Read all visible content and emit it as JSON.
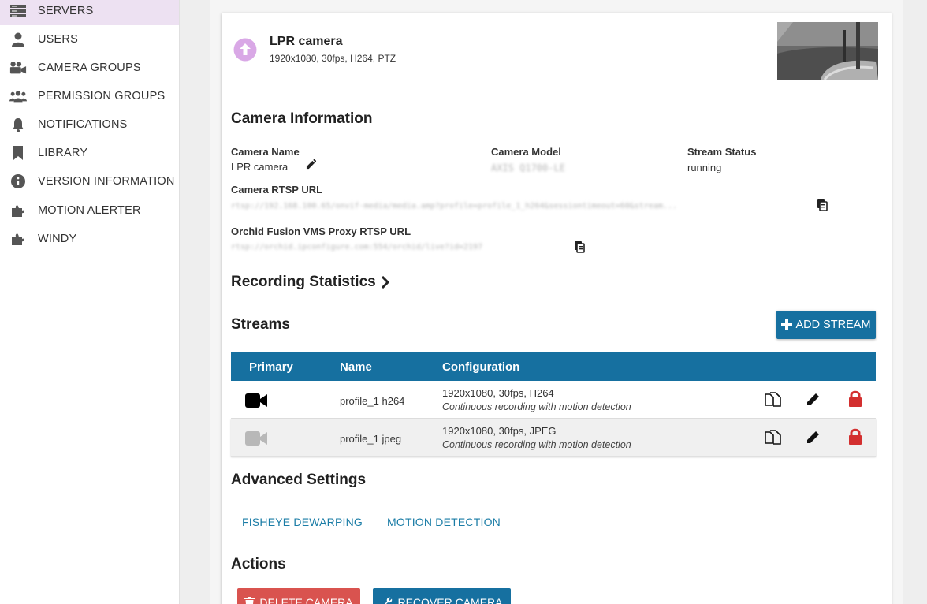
{
  "sidebar": {
    "items": [
      {
        "label": "SERVERS",
        "icon": "servers-icon",
        "active": true
      },
      {
        "label": "USERS",
        "icon": "user-icon"
      },
      {
        "label": "CAMERA GROUPS",
        "icon": "camera-groups-icon"
      },
      {
        "label": "PERMISSION GROUPS",
        "icon": "users-group-icon"
      },
      {
        "label": "NOTIFICATIONS",
        "icon": "bell-icon"
      },
      {
        "label": "LIBRARY",
        "icon": "bookmark-icon"
      },
      {
        "label": "VERSION INFORMATION",
        "icon": "info-icon"
      },
      {
        "label": "MOTION ALERTER",
        "icon": "puzzle-icon"
      },
      {
        "label": "WINDY",
        "icon": "puzzle-icon"
      }
    ]
  },
  "camera": {
    "title": "LPR camera",
    "subtitle": "1920x1080, 30fps, H264, PTZ"
  },
  "info": {
    "section_title": "Camera Information",
    "name_label": "Camera Name",
    "name_value": "LPR camera",
    "model_label": "Camera Model",
    "model_value": "AXIS Q1700-LE",
    "status_label": "Stream Status",
    "status_value": "running",
    "rtsp_label": "Camera RTSP URL",
    "rtsp_value": "rtsp://192.168.100.65/onvif-media/media.amp?profile=profile_1_h264&sessiontimeout=60&stream...",
    "proxy_label": "Orchid Fusion VMS Proxy RTSP URL",
    "proxy_value": "rtsp://orchid.ipconfigure.com:554/orchid/live?id=2197"
  },
  "recording": {
    "title": "Recording Statistics"
  },
  "streams": {
    "title": "Streams",
    "add_label": "ADD STREAM",
    "columns": [
      "Primary",
      "Name",
      "Configuration"
    ],
    "rows": [
      {
        "name": "profile_1 h264",
        "config": "1920x1080, 30fps, H264",
        "detail": "Continuous recording with motion detection",
        "primary": true
      },
      {
        "name": "profile_1 jpeg",
        "config": "1920x1080, 30fps, JPEG",
        "detail": "Continuous recording with motion detection",
        "primary": false
      }
    ]
  },
  "advanced": {
    "title": "Advanced Settings",
    "tabs": [
      "FISHEYE DEWARPING",
      "MOTION DETECTION"
    ]
  },
  "actions": {
    "title": "Actions",
    "delete_label": "DELETE CAMERA",
    "recover_label": "RECOVER CAMERA"
  },
  "colors": {
    "accent": "#1670a0",
    "active_nav": "#ede1f2",
    "lock": "#d32f2f",
    "upload_circle": "#d9a8e6",
    "link": "#1a7ca6"
  }
}
